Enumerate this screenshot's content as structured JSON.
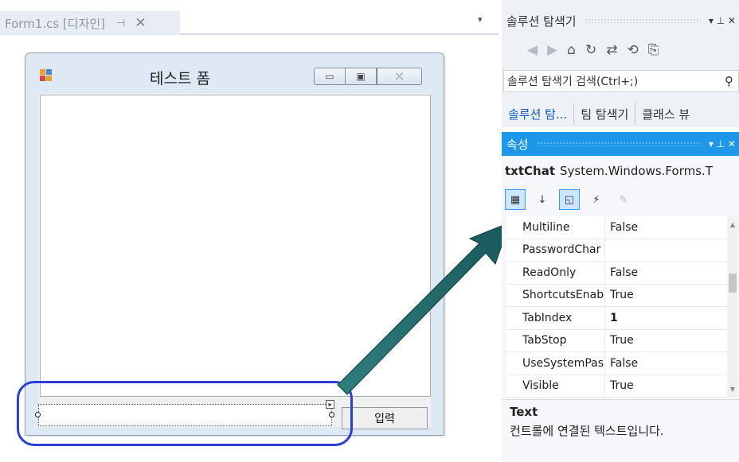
{
  "document_tab": {
    "title": "Form1.cs [디자인]",
    "pin_icon": "pin-icon",
    "close_glyph": "✕",
    "dropdown_glyph": "▾"
  },
  "form": {
    "title": "테스트 폼",
    "min_glyph": "▭",
    "max_glyph": "▣",
    "close_glyph": "⤫",
    "input_button_label": "입력",
    "smart_tag_glyph": "▸"
  },
  "solution_explorer": {
    "title": "솔루션 탐색기",
    "controls": "▾ ⊥ ✕",
    "toolbar_icons": [
      "◀",
      "▶",
      "⌂",
      "↻",
      "⇄",
      "⟲",
      "⎘"
    ],
    "search_placeholder": "솔루션 탐색기 검색(Ctrl+;)",
    "search_glyph": "⚲",
    "tabs": [
      "솔루션 탐...",
      "팀 탐색기",
      "클래스 뷰"
    ]
  },
  "properties": {
    "title": "속성",
    "controls": "▾ ⊥ ✕",
    "object_name": "txtChat",
    "object_type": "System.Windows.Forms.T",
    "rows": [
      {
        "name": "Multiline",
        "value": "False"
      },
      {
        "name": "PasswordChar",
        "value": ""
      },
      {
        "name": "ReadOnly",
        "value": "False"
      },
      {
        "name": "ShortcutsEnab",
        "value": "True"
      },
      {
        "name": "TabIndex",
        "value": "1"
      },
      {
        "name": "TabStop",
        "value": "True"
      },
      {
        "name": "UseSystemPas:",
        "value": "False"
      },
      {
        "name": "Visible",
        "value": "True"
      }
    ],
    "desc_title": "Text",
    "desc_text": "컨트롤에 연결된 텍스트입니다."
  },
  "colors": {
    "accent": "#1c97ea",
    "ellipse": "#2b3fd6",
    "arrow": "#1f6b6b"
  }
}
